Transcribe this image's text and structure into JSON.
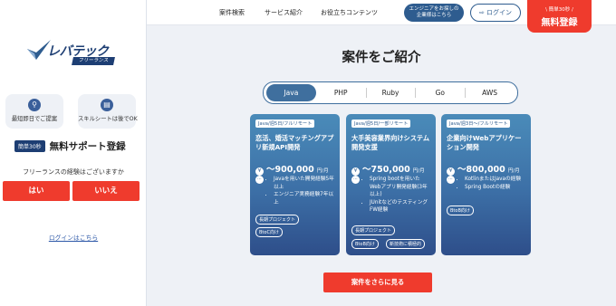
{
  "sidebar": {
    "logo_text": "レバテック",
    "logo_sub": "フリーランス",
    "features": [
      {
        "icon": "search-icon",
        "label": "最短即日でご提案"
      },
      {
        "icon": "document-icon",
        "label": "スキルシートは後でOK"
      }
    ],
    "promo_badge": "簡単30秒",
    "promo_text": "無料サポート登録",
    "question": "フリーランスの経験はございますか",
    "yes_label": "はい",
    "no_label": "いいえ",
    "login_link": "ログインはこちら"
  },
  "header": {
    "nav": [
      "案件検索",
      "サービス紹介",
      "お役立ちコンテンツ"
    ],
    "engineer_btn": [
      "エンジニアをお探しの",
      "企業様はこちら"
    ],
    "login_btn": "ログイン",
    "free_btn_small": "\\ 簡単30秒 /",
    "free_btn_big": "無料登録"
  },
  "main": {
    "title": "案件をご紹介",
    "tabs": [
      "Java",
      "PHP",
      "Ruby",
      "Go",
      "AWS"
    ],
    "active_tab": "Java",
    "cards": [
      {
        "badge": "Java/週5日/フルリモート",
        "title": "恋活、婚活マッチングアプリ新規API開発",
        "price": "〜900,000",
        "unit": "円/月",
        "skills": [
          "Javaを用いた開発経験5年以上",
          "エンジニア実務経験7年以上"
        ],
        "tags": [
          "長期プロジェクト",
          "BtoC向け"
        ]
      },
      {
        "badge": "Java/週5日/一部リモート",
        "title": "大手美容業界向けシステム開発支援",
        "price": "〜750,000",
        "unit": "円/月",
        "skills": [
          "Spring bootを用いたWebアプリ開発経験(3年以上)",
          "JUnitなどのテスティングFW経験"
        ],
        "tags": [
          "長期プロジェクト",
          "BtoB向け",
          "新技術に積極的"
        ]
      },
      {
        "badge": "Java/週3日〜/フルリモート",
        "title": "企業向けWebアプリケーション開発",
        "price": "〜800,000",
        "unit": "円/月",
        "skills": [
          "KotlinまたはJavaの経験",
          "Spring Bootの経験"
        ],
        "tags": [
          "BtoB向け"
        ]
      }
    ],
    "cta": "案件をさらに見る"
  }
}
